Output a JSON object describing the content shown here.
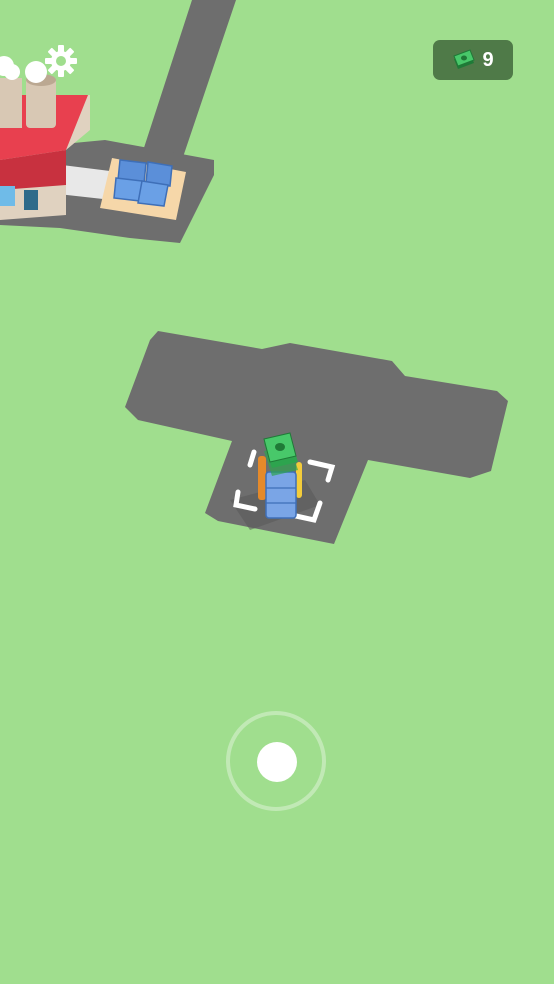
{
  "hud": {
    "cash_amount": "9",
    "cash_icon": "money-stack-icon",
    "settings_icon": "gear-icon"
  },
  "player": {
    "carried_stack_icon": "money-stack-icon"
  },
  "colors": {
    "ground": "#a0de8e",
    "road": "#6e6e6e",
    "factory_roof": "#e8404f",
    "crate": "#5b8fd9",
    "cash_badge": "#4f7a48"
  }
}
